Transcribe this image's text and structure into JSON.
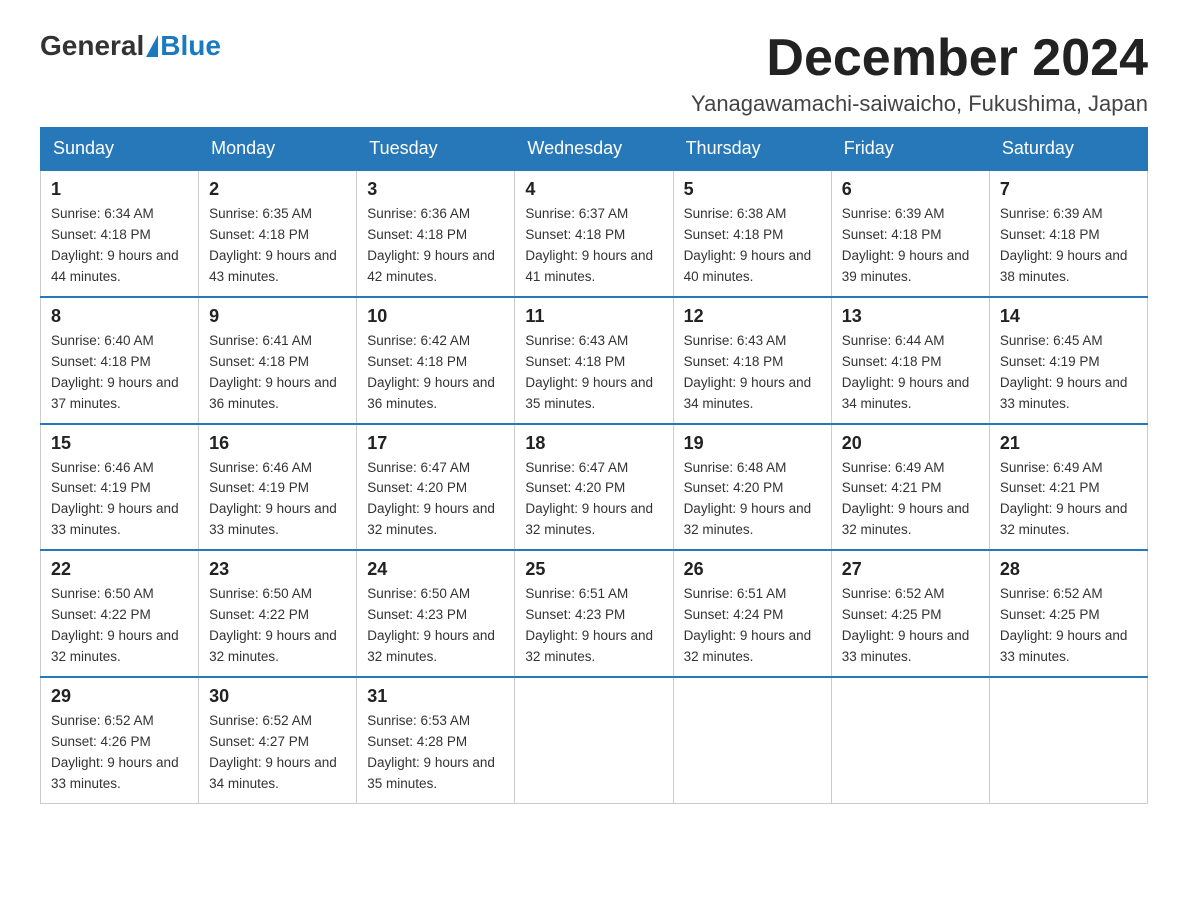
{
  "header": {
    "logo_general": "General",
    "logo_blue": "Blue",
    "month_title": "December 2024",
    "location": "Yanagawamachi-saiwaicho, Fukushima, Japan"
  },
  "columns": [
    "Sunday",
    "Monday",
    "Tuesday",
    "Wednesday",
    "Thursday",
    "Friday",
    "Saturday"
  ],
  "weeks": [
    [
      {
        "day": "1",
        "sunrise": "6:34 AM",
        "sunset": "4:18 PM",
        "daylight": "9 hours and 44 minutes."
      },
      {
        "day": "2",
        "sunrise": "6:35 AM",
        "sunset": "4:18 PM",
        "daylight": "9 hours and 43 minutes."
      },
      {
        "day": "3",
        "sunrise": "6:36 AM",
        "sunset": "4:18 PM",
        "daylight": "9 hours and 42 minutes."
      },
      {
        "day": "4",
        "sunrise": "6:37 AM",
        "sunset": "4:18 PM",
        "daylight": "9 hours and 41 minutes."
      },
      {
        "day": "5",
        "sunrise": "6:38 AM",
        "sunset": "4:18 PM",
        "daylight": "9 hours and 40 minutes."
      },
      {
        "day": "6",
        "sunrise": "6:39 AM",
        "sunset": "4:18 PM",
        "daylight": "9 hours and 39 minutes."
      },
      {
        "day": "7",
        "sunrise": "6:39 AM",
        "sunset": "4:18 PM",
        "daylight": "9 hours and 38 minutes."
      }
    ],
    [
      {
        "day": "8",
        "sunrise": "6:40 AM",
        "sunset": "4:18 PM",
        "daylight": "9 hours and 37 minutes."
      },
      {
        "day": "9",
        "sunrise": "6:41 AM",
        "sunset": "4:18 PM",
        "daylight": "9 hours and 36 minutes."
      },
      {
        "day": "10",
        "sunrise": "6:42 AM",
        "sunset": "4:18 PM",
        "daylight": "9 hours and 36 minutes."
      },
      {
        "day": "11",
        "sunrise": "6:43 AM",
        "sunset": "4:18 PM",
        "daylight": "9 hours and 35 minutes."
      },
      {
        "day": "12",
        "sunrise": "6:43 AM",
        "sunset": "4:18 PM",
        "daylight": "9 hours and 34 minutes."
      },
      {
        "day": "13",
        "sunrise": "6:44 AM",
        "sunset": "4:18 PM",
        "daylight": "9 hours and 34 minutes."
      },
      {
        "day": "14",
        "sunrise": "6:45 AM",
        "sunset": "4:19 PM",
        "daylight": "9 hours and 33 minutes."
      }
    ],
    [
      {
        "day": "15",
        "sunrise": "6:46 AM",
        "sunset": "4:19 PM",
        "daylight": "9 hours and 33 minutes."
      },
      {
        "day": "16",
        "sunrise": "6:46 AM",
        "sunset": "4:19 PM",
        "daylight": "9 hours and 33 minutes."
      },
      {
        "day": "17",
        "sunrise": "6:47 AM",
        "sunset": "4:20 PM",
        "daylight": "9 hours and 32 minutes."
      },
      {
        "day": "18",
        "sunrise": "6:47 AM",
        "sunset": "4:20 PM",
        "daylight": "9 hours and 32 minutes."
      },
      {
        "day": "19",
        "sunrise": "6:48 AM",
        "sunset": "4:20 PM",
        "daylight": "9 hours and 32 minutes."
      },
      {
        "day": "20",
        "sunrise": "6:49 AM",
        "sunset": "4:21 PM",
        "daylight": "9 hours and 32 minutes."
      },
      {
        "day": "21",
        "sunrise": "6:49 AM",
        "sunset": "4:21 PM",
        "daylight": "9 hours and 32 minutes."
      }
    ],
    [
      {
        "day": "22",
        "sunrise": "6:50 AM",
        "sunset": "4:22 PM",
        "daylight": "9 hours and 32 minutes."
      },
      {
        "day": "23",
        "sunrise": "6:50 AM",
        "sunset": "4:22 PM",
        "daylight": "9 hours and 32 minutes."
      },
      {
        "day": "24",
        "sunrise": "6:50 AM",
        "sunset": "4:23 PM",
        "daylight": "9 hours and 32 minutes."
      },
      {
        "day": "25",
        "sunrise": "6:51 AM",
        "sunset": "4:23 PM",
        "daylight": "9 hours and 32 minutes."
      },
      {
        "day": "26",
        "sunrise": "6:51 AM",
        "sunset": "4:24 PM",
        "daylight": "9 hours and 32 minutes."
      },
      {
        "day": "27",
        "sunrise": "6:52 AM",
        "sunset": "4:25 PM",
        "daylight": "9 hours and 33 minutes."
      },
      {
        "day": "28",
        "sunrise": "6:52 AM",
        "sunset": "4:25 PM",
        "daylight": "9 hours and 33 minutes."
      }
    ],
    [
      {
        "day": "29",
        "sunrise": "6:52 AM",
        "sunset": "4:26 PM",
        "daylight": "9 hours and 33 minutes."
      },
      {
        "day": "30",
        "sunrise": "6:52 AM",
        "sunset": "4:27 PM",
        "daylight": "9 hours and 34 minutes."
      },
      {
        "day": "31",
        "sunrise": "6:53 AM",
        "sunset": "4:28 PM",
        "daylight": "9 hours and 35 minutes."
      },
      null,
      null,
      null,
      null
    ]
  ]
}
